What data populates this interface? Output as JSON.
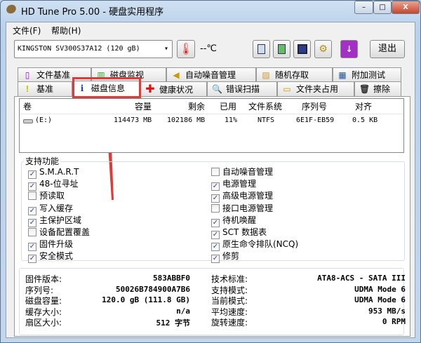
{
  "window": {
    "title": "HD Tune Pro 5.00 - 硬盘实用程序",
    "controls": [
      "–",
      "□",
      "X"
    ]
  },
  "menu": [
    "文件(F)",
    "帮助(H)"
  ],
  "toolbar": {
    "drive": "KINGSTON SV300S37A12        (120 gB)",
    "temperature": "--℃",
    "exit": "退出",
    "icons": [
      "copy-text-icon",
      "copy-screenshot-icon",
      "save-icon",
      "options-icon",
      "download-icon"
    ]
  },
  "tabs_row1": [
    "文件基准",
    "磁盘监视",
    "自动噪音管理",
    "随机存取",
    "附加测试"
  ],
  "tabs_row2": [
    "基准",
    "磁盘信息",
    "健康状况",
    "错误扫描",
    "文件夹占用",
    "擦除"
  ],
  "selected_tab": "磁盘信息",
  "highlight_color": "#e53935",
  "volumes": {
    "headers": [
      "卷",
      "容量",
      "剩余",
      "已用",
      "文件系统",
      "序列号",
      "对齐"
    ],
    "rows": [
      [
        "(E:)",
        "114473 MB",
        "102186 MB",
        "11%",
        "NTFS",
        "6E1F-EB59",
        "0.5 KB"
      ]
    ]
  },
  "features": {
    "title": "支持功能",
    "left": [
      {
        "label": "S.M.A.R.T",
        "checked": true
      },
      {
        "label": "48-位寻址",
        "checked": true
      },
      {
        "label": "预读取",
        "checked": false
      },
      {
        "label": "写入缓存",
        "checked": true
      },
      {
        "label": "主保护区域",
        "checked": true
      },
      {
        "label": "设备配置覆盖",
        "checked": false
      },
      {
        "label": "固件升级",
        "checked": true
      },
      {
        "label": "安全模式",
        "checked": true
      }
    ],
    "right": [
      {
        "label": "自动噪音管理",
        "checked": false
      },
      {
        "label": "电源管理",
        "checked": true
      },
      {
        "label": "高级电源管理",
        "checked": true
      },
      {
        "label": "接口电源管理",
        "checked": false
      },
      {
        "label": "待机唤醒",
        "checked": true
      },
      {
        "label": "SCT 数据表",
        "checked": true
      },
      {
        "label": "原生命令排队(NCQ)",
        "checked": true
      },
      {
        "label": "修剪",
        "checked": true
      }
    ]
  },
  "info": {
    "left": [
      {
        "label": "固件版本:",
        "value": "583ABBF0"
      },
      {
        "label": "序列号:",
        "value": "50026B784900A7B6"
      },
      {
        "label": "磁盘容量:",
        "value": "120.0 gB (111.8 GB)"
      },
      {
        "label": "缓存大小:",
        "value": "n/a"
      },
      {
        "label": "扇区大小:",
        "value": "512 字节"
      }
    ],
    "right": [
      {
        "label": "技术标准:",
        "value": "ATA8-ACS - SATA III"
      },
      {
        "label": "支持模式:",
        "value": "UDMA Mode 6"
      },
      {
        "label": "当前模式:",
        "value": "UDMA Mode 6"
      },
      {
        "label": "平均速度:",
        "value": "953 MB/s"
      },
      {
        "label": "旋转速度:",
        "value": "0 RPM"
      }
    ]
  }
}
